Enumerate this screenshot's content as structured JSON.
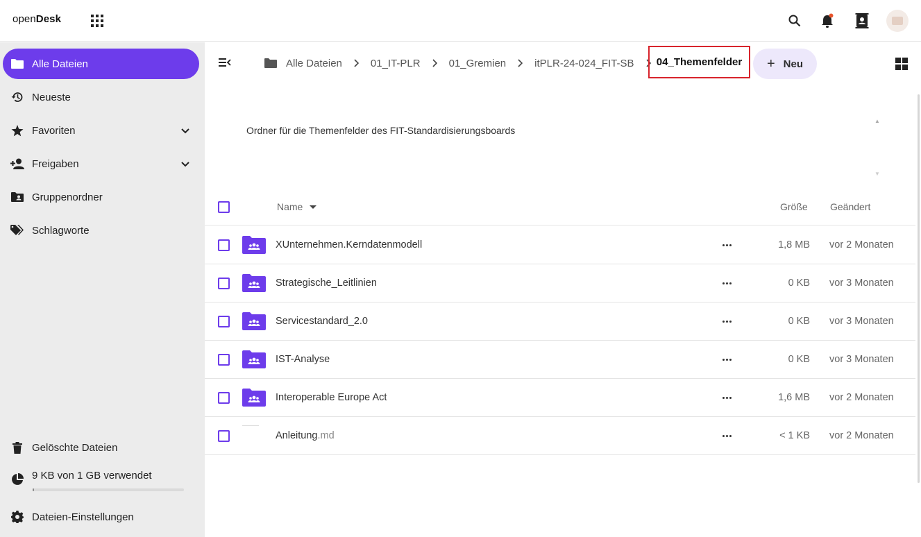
{
  "header": {
    "logo_prefix": "open",
    "logo_bold": "Desk",
    "icons": [
      "apps-grid-icon",
      "search-icon",
      "bell-icon",
      "contacts-icon",
      "avatar"
    ],
    "accent": "#6d3ceb",
    "notification_dot": "#e8542b"
  },
  "sidebar": {
    "items": [
      {
        "label": "Alle Dateien",
        "icon": "folder-icon",
        "active": true
      },
      {
        "label": "Neueste",
        "icon": "history-icon"
      },
      {
        "label": "Favoriten",
        "icon": "star-icon",
        "expandable": true
      },
      {
        "label": "Freigaben",
        "icon": "share-user-icon",
        "expandable": true
      },
      {
        "label": "Gruppenordner",
        "icon": "group-folder-icon"
      },
      {
        "label": "Schlagworte",
        "icon": "tag-icon"
      }
    ],
    "bottom": {
      "deleted": "Gelöschte Dateien",
      "quota": "9 KB von 1 GB verwendet",
      "quota_fraction": 1e-05,
      "settings": "Dateien-Einstellungen"
    }
  },
  "breadcrumb": {
    "items": [
      "Alle Dateien",
      "01_IT-PLR",
      "01_Gremien",
      "itPLR-24-024_FIT-SB"
    ],
    "current": "04_Themenfelder"
  },
  "toolbar": {
    "new_label": "Neu"
  },
  "description": "Ordner für die Themenfelder des FIT-Standardisierungsboards",
  "table": {
    "headers": {
      "name": "Name",
      "size": "Größe",
      "modified": "Geändert"
    },
    "rows": [
      {
        "name": "XUnternehmen.Kerndatenmodell",
        "ext": "",
        "size": "1,8 MB",
        "modified": "vor 2 Monaten",
        "type": "group-folder"
      },
      {
        "name": "Strategische_Leitlinien",
        "ext": "",
        "size": "0 KB",
        "modified": "vor 3 Monaten",
        "type": "group-folder"
      },
      {
        "name": "Servicestandard_2.0",
        "ext": "",
        "size": "0 KB",
        "modified": "vor 3 Monaten",
        "type": "group-folder"
      },
      {
        "name": "IST-Analyse",
        "ext": "",
        "size": "0 KB",
        "modified": "vor 3 Monaten",
        "type": "group-folder"
      },
      {
        "name": "Interoperable Europe Act",
        "ext": "",
        "size": "1,6 MB",
        "modified": "vor 2 Monaten",
        "type": "group-folder"
      },
      {
        "name": "Anleitung",
        "ext": ".md",
        "size": "< 1 KB",
        "modified": "vor 2 Monaten",
        "type": "file"
      }
    ]
  }
}
